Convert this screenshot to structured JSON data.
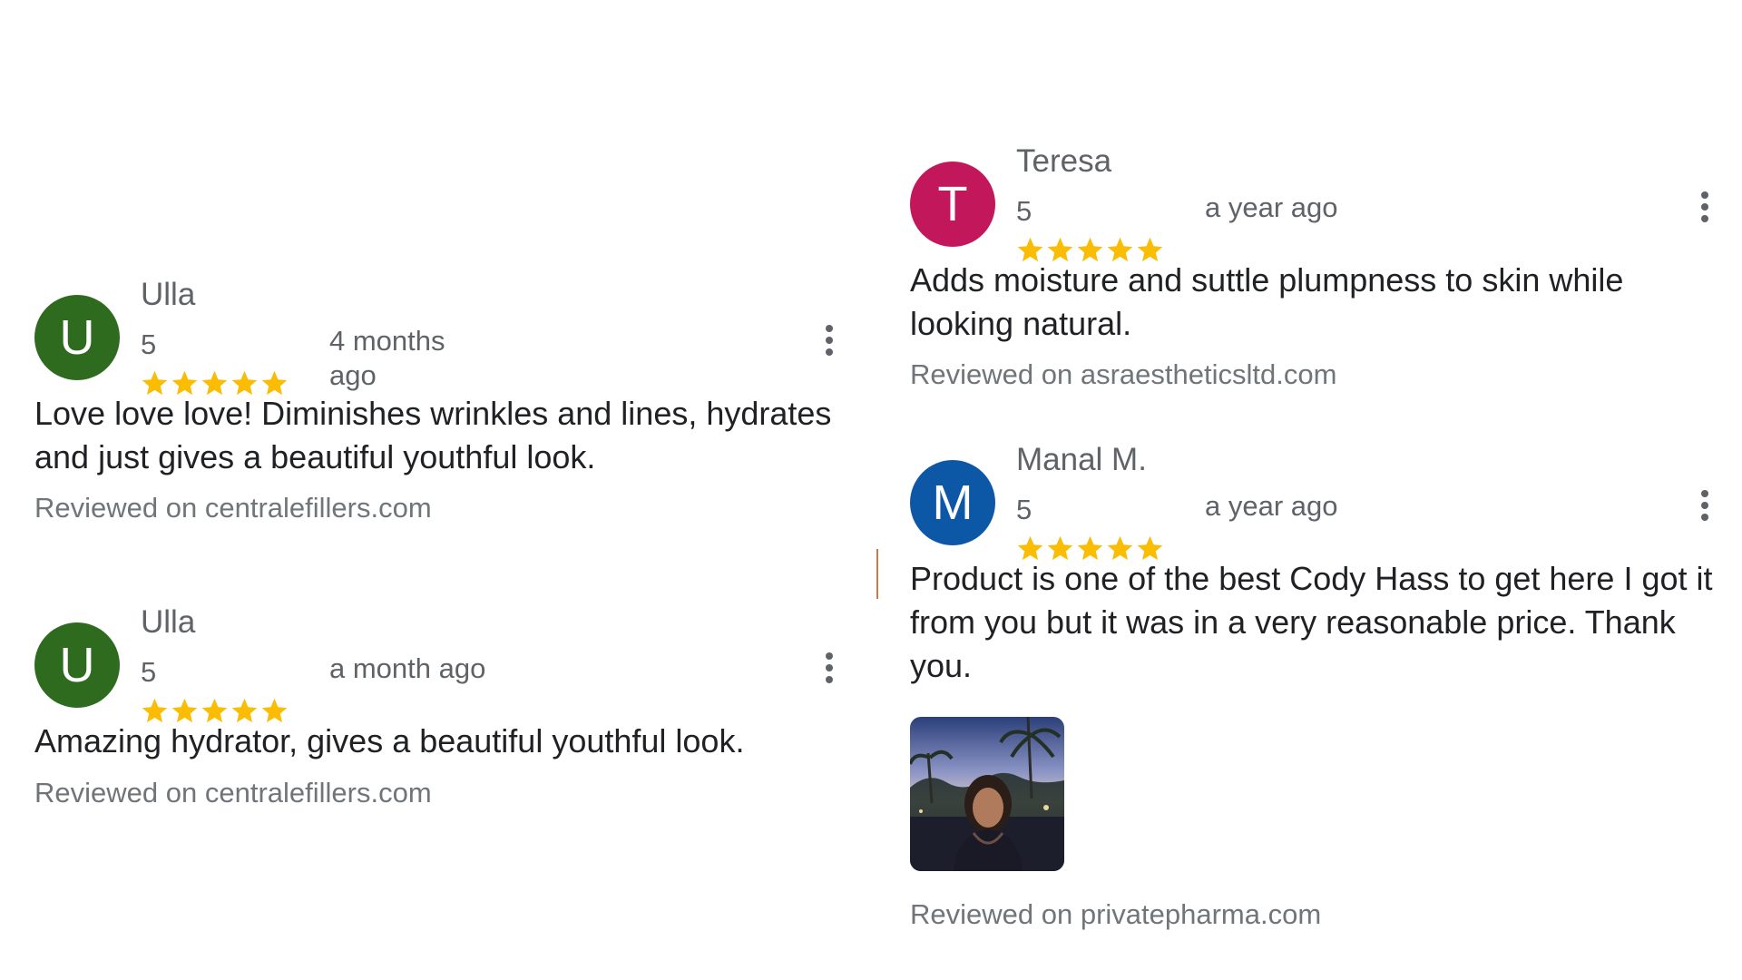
{
  "colors": {
    "star": "#fbbc04",
    "avatar_green": "#2e6b1f",
    "avatar_pink": "#c2185b",
    "avatar_blue": "#0d57a7"
  },
  "reviews": [
    {
      "initial": "U",
      "name": "Ulla",
      "rating": "5",
      "time": "4 months ago",
      "text": "Love love love! Diminishes wrinkles and lines, hydrates and just gives a beautiful youthful look.",
      "source_prefix": "Reviewed on",
      "source_site": "centralefillers.com",
      "menu_icon": "more-vert-icon"
    },
    {
      "initial": "U",
      "name": "Ulla",
      "rating": "5",
      "time": "a month ago",
      "text": "Amazing hydrator, gives a beautiful youthful look.",
      "source_prefix": "Reviewed on",
      "source_site": "centralefillers.com",
      "menu_icon": "more-vert-icon"
    },
    {
      "initial": "T",
      "name": "Teresa",
      "rating": "5",
      "time": "a year ago",
      "text": "Adds moisture and suttle plumpness to skin while looking natural.",
      "source_prefix": "Reviewed on",
      "source_site": "asraestheticsltd.com",
      "menu_icon": "more-vert-icon"
    },
    {
      "initial": "M",
      "name": "Manal M.",
      "rating": "5",
      "time": "a year ago",
      "text": "Product is one of the best Cody Hass to get here I got it from you but it was in a very reasonable price. Thank you.",
      "source_prefix": "Reviewed on",
      "source_site": "privatepharma.com",
      "menu_icon": "more-vert-icon"
    }
  ]
}
